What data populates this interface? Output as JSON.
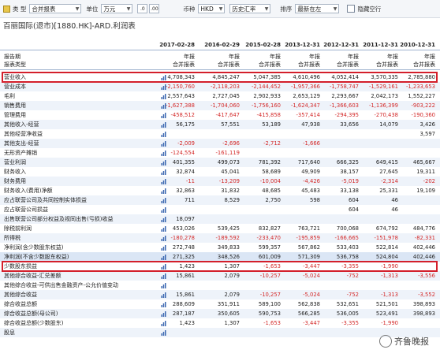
{
  "toolbar": {
    "type_label": "类  型",
    "type_value": "合并报表",
    "unit_label": "单位",
    "unit_value": "万元",
    "currency_label": "币种",
    "currency_value": "HKD",
    "rate_value": "历史汇率",
    "sort_label": "排序",
    "sort_value": "最新在左",
    "hide_empty_label": "隐藏空行"
  },
  "title": "百丽国际(退市)[1880.HK]-ARD.利润表",
  "header": {
    "dates": [
      "2017-02-28",
      "2016-02-29",
      "2015-02-28",
      "2013-12-31",
      "2012-12-31",
      "2011-12-31",
      "2010-12-31"
    ],
    "row1_label": "报告期",
    "row1_values": [
      "年报",
      "年报",
      "年报",
      "年报",
      "年报",
      "年报",
      "年报"
    ],
    "row2_label": "报表类型",
    "row2_values": [
      "合并报表",
      "合并报表",
      "合并报表",
      "合并报表",
      "合并报表",
      "合并报表",
      "合并报表"
    ]
  },
  "rows": [
    {
      "label": "营业收入",
      "values": [
        "4,708,343",
        "4,845,247",
        "5,047,385",
        "4,610,496",
        "4,052,414",
        "3,570,335",
        "2,785,880"
      ]
    },
    {
      "label": "营业成本",
      "values": [
        "-2,150,760",
        "-2,118,203",
        "-2,144,452",
        "-1,957,366",
        "-1,758,747",
        "-1,529,161",
        "-1,233,653"
      ]
    },
    {
      "label": "毛利",
      "values": [
        "2,557,643",
        "2,727,045",
        "2,902,933",
        "2,653,129",
        "2,293,667",
        "2,042,173",
        "1,552,227"
      ]
    },
    {
      "label": "销售费用",
      "values": [
        "-1,627,388",
        "-1,704,060",
        "-1,756,160",
        "-1,624,347",
        "-1,366,603",
        "-1,136,399",
        "-903,222"
      ]
    },
    {
      "label": "管理费用",
      "values": [
        "-458,512",
        "-417,647",
        "-415,858",
        "-357,414",
        "-294,395",
        "-270,438",
        "-190,360"
      ]
    },
    {
      "label": "其他收入-经营",
      "values": [
        "56,175",
        "57,551",
        "53,189",
        "47,938",
        "33,656",
        "14,079",
        "3,426"
      ]
    },
    {
      "label": "其他经营净收益",
      "values": [
        "",
        "",
        "",
        "",
        "",
        "",
        "3,597"
      ]
    },
    {
      "label": "其他支出-经营",
      "values": [
        "-2,009",
        "-2,696",
        "-2,712",
        "-1,666",
        "",
        "",
        ""
      ]
    },
    {
      "label": "无形资产摊销",
      "values": [
        "-124,554",
        "-161,119",
        "",
        "",
        "",
        "",
        ""
      ]
    },
    {
      "label": "营业利润",
      "values": [
        "401,355",
        "499,073",
        "781,392",
        "717,640",
        "666,325",
        "649,415",
        "465,667"
      ]
    },
    {
      "label": "财务收入",
      "values": [
        "32,874",
        "45,041",
        "58,689",
        "49,909",
        "38,157",
        "27,645",
        "19,311"
      ]
    },
    {
      "label": "财务费用",
      "values": [
        "-11",
        "-13,209",
        "-10,004",
        "-4,426",
        "-5,019",
        "-2,314",
        "-202"
      ]
    },
    {
      "label": "财务收入(费用)净额",
      "values": [
        "32,863",
        "31,832",
        "48,685",
        "45,483",
        "33,138",
        "25,331",
        "19,109"
      ]
    },
    {
      "label": "应占联营公司及共同控制实体损益",
      "values": [
        "711",
        "8,529",
        "2,750",
        "598",
        "604",
        "46",
        ""
      ]
    },
    {
      "label": "应占联营公司损益",
      "values": [
        "",
        "",
        "",
        "",
        "604",
        "46",
        ""
      ]
    },
    {
      "label": "出售联营公司部分权益及视同出售(亏损)收益",
      "values": [
        "18,097",
        "",
        "",
        "",
        "",
        "",
        ""
      ]
    },
    {
      "label": "除税前利润",
      "values": [
        "453,026",
        "539,425",
        "832,827",
        "763,721",
        "700,068",
        "674,792",
        "484,776"
      ]
    },
    {
      "label": "所得税",
      "values": [
        "-180,278",
        "-189,592",
        "-233,470",
        "-195,859",
        "-166,665",
        "-151,978",
        "-82,331"
      ]
    },
    {
      "label": "净利润(含少数股东权益)",
      "values": [
        "272,748",
        "349,833",
        "599,357",
        "567,862",
        "533,403",
        "522,814",
        "402,446"
      ]
    },
    {
      "label": "净利润(不含少数股东权益)",
      "values": [
        "271,325",
        "348,526",
        "601,009",
        "571,309",
        "536,758",
        "524,804",
        "402,446"
      ]
    },
    {
      "label": "少数股东损益",
      "values": [
        "1,423",
        "1,307",
        "-1,653",
        "-3,447",
        "-3,355",
        "-1,990",
        ""
      ]
    },
    {
      "label": "其他综合收益-汇兑差额",
      "values": [
        "15,861",
        "2,079",
        "-10,257",
        "-5,024",
        "-752",
        "-1,313",
        "-3,556"
      ]
    },
    {
      "label": "其他综合收益-可供出售金融资产-公允价值变动",
      "values": [
        "",
        "",
        "",
        "",
        "",
        "",
        ""
      ]
    },
    {
      "label": "其他综合收益",
      "values": [
        "15,861",
        "2,079",
        "-10,257",
        "-5,024",
        "-752",
        "-1,313",
        "-3,552"
      ]
    },
    {
      "label": "综合收益总额",
      "values": [
        "288,609",
        "351,911",
        "589,100",
        "562,838",
        "532,651",
        "521,501",
        "398,893"
      ]
    },
    {
      "label": "综合收益总额(母公司)",
      "values": [
        "287,187",
        "350,605",
        "590,753",
        "566,285",
        "536,005",
        "523,491",
        "398,893"
      ]
    },
    {
      "label": "综合收益总额(少数股东)",
      "values": [
        "1,423",
        "1,307",
        "-1,653",
        "-3,447",
        "-3,355",
        "-1,990",
        ""
      ]
    },
    {
      "label": "股息",
      "values": [
        "",
        "",
        "",
        "",
        "",
        "",
        ""
      ]
    }
  ],
  "watermark": "齐鲁晚报",
  "colors": {
    "highlight_box": "#d31f2b",
    "negative": "#d42a2a",
    "header_line": "#9fb3cf"
  }
}
